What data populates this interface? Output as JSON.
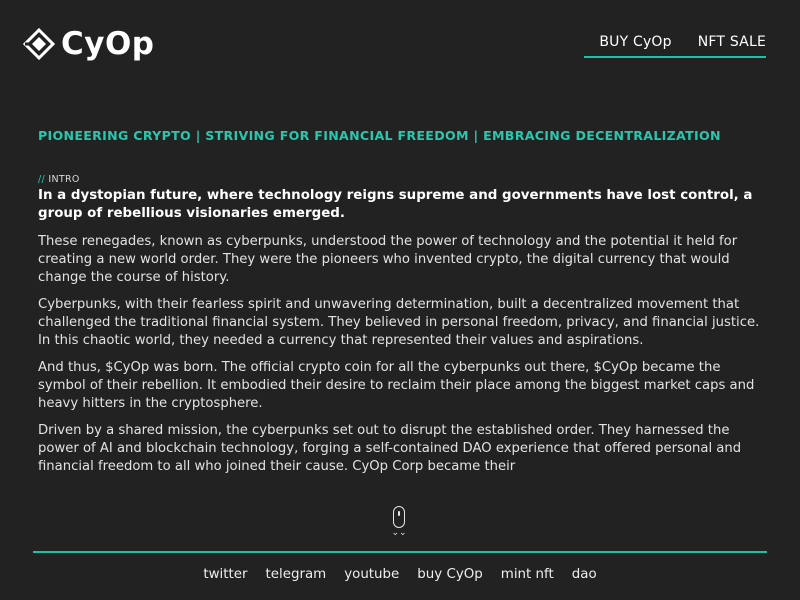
{
  "header": {
    "brand": "CyOp",
    "nav": {
      "buy_label": "BUY CyOp",
      "nft_label": "NFT SALE"
    }
  },
  "tagline": "PIONEERING CRYPTO | STRIVING FOR FINANCIAL FREEDOM | EMBRACING DECENTRALIZATION",
  "content": {
    "intro_slashes": "//",
    "intro_label": "INTRO",
    "lead": "In a dystopian future, where technology reigns supreme and governments have lost control, a group of rebellious visionaries emerged.",
    "paragraphs": [
      "These renegades, known as cyberpunks, understood the power of technology and the potential it held for creating a new world order. They were the pioneers who invented crypto, the digital currency that would change the course of history.",
      "Cyberpunks, with their fearless spirit and unwavering determination, built a decentralized movement that challenged the traditional financial system. They believed in personal freedom, privacy, and financial justice. In this chaotic world, they needed a currency that represented their values and aspirations.",
      "And thus, $CyOp was born. The official crypto coin for all the cyberpunks out there, $CyOp became the symbol of their rebellion. It embodied their desire to reclaim their place among the biggest market caps and heavy hitters in the cryptosphere.",
      "Driven by a shared mission, the cyberpunks set out to disrupt the established order. They harnessed the power of AI and blockchain technology, forging a self-contained DAO experience that offered personal and financial freedom to all who joined their cause. CyOp Corp became their"
    ]
  },
  "scroll_hint": {
    "chevron": "⌄⌄"
  },
  "footer": {
    "links": [
      "twitter",
      "telegram",
      "youtube",
      "buy CyOp",
      "mint nft",
      "dao"
    ]
  },
  "colors": {
    "background": "#232222",
    "accent": "#28c7ae",
    "text": "#e2e2e2"
  }
}
